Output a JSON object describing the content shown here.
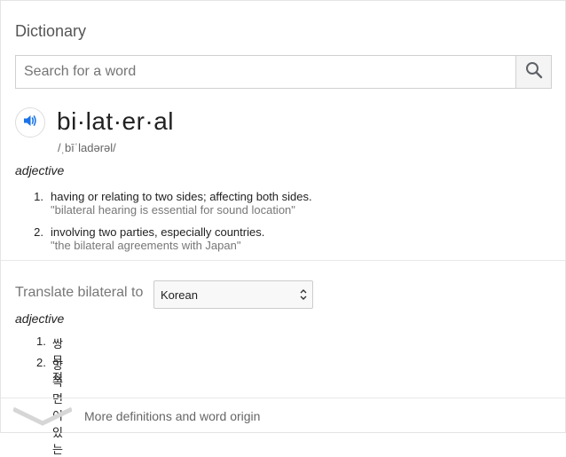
{
  "panel": {
    "title": "Dictionary"
  },
  "search": {
    "placeholder": "Search for a word",
    "value": "",
    "button_icon": "magnifier-icon"
  },
  "entry": {
    "audio_icon": "speaker-icon",
    "headword": "bi·lat·er·al",
    "phonetic": "/ˌbīˈladərəl/",
    "part_of_speech": "adjective",
    "definitions": [
      {
        "number": "1.",
        "text": "having or relating to two sides; affecting both sides.",
        "example": "\"bilateral hearing is essential for sound location\""
      },
      {
        "number": "2.",
        "text": "involving two parties, especially countries.",
        "example": "\"the bilateral agreements with Japan\""
      }
    ]
  },
  "translate": {
    "label": "Translate bilateral to",
    "selected_language": "Korean",
    "part_of_speech": "adjective",
    "items": [
      {
        "number": "1.",
        "text": "쌍무적"
      },
      {
        "number": "2.",
        "text": "양쪽면이 있는"
      }
    ]
  },
  "footer": {
    "more_label": "More definitions and word origin",
    "chevron_icon": "chevron-down-icon"
  },
  "colors": {
    "accent": "#1a73e8",
    "text": "#222222",
    "muted": "#777777"
  }
}
